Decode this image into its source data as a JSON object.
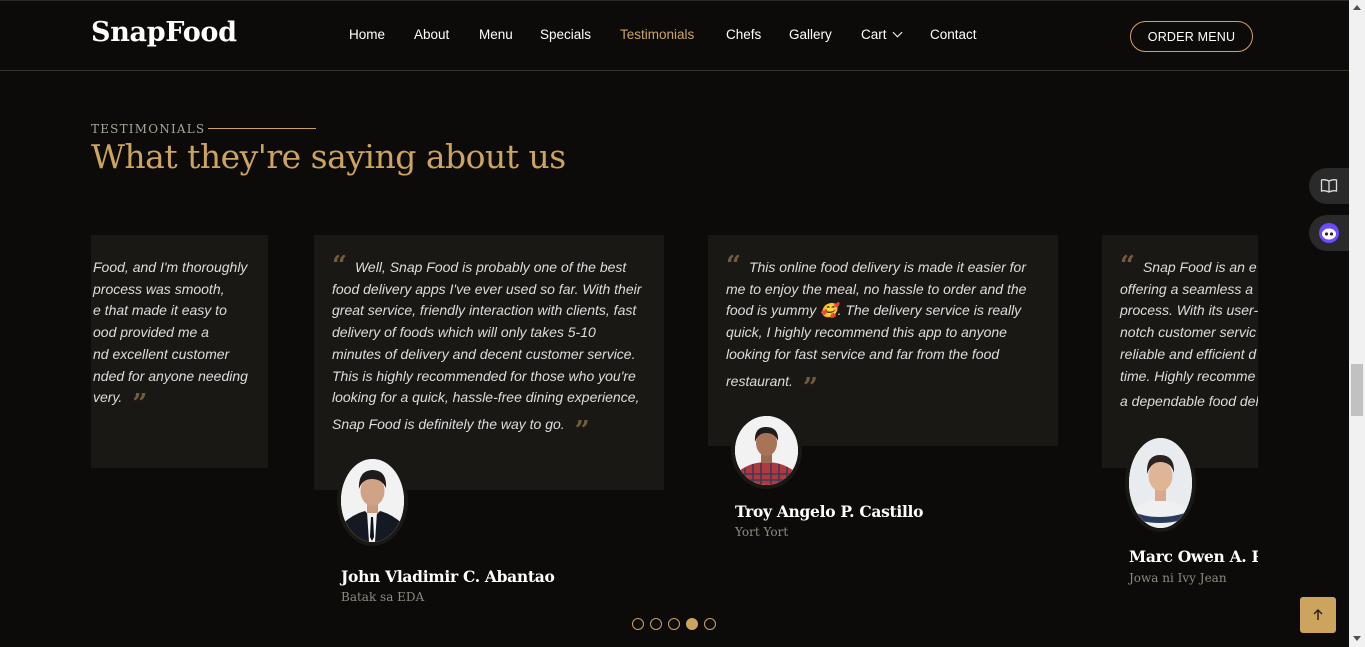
{
  "header": {
    "logo": "SnapFood",
    "nav": [
      {
        "label": "Home",
        "active": false
      },
      {
        "label": "About",
        "active": false
      },
      {
        "label": "Menu",
        "active": false
      },
      {
        "label": "Specials",
        "active": false
      },
      {
        "label": "Testimonials",
        "active": true
      },
      {
        "label": "Chefs",
        "active": false
      },
      {
        "label": "Gallery",
        "active": false
      },
      {
        "label": "Cart",
        "active": false,
        "dropdown": true
      },
      {
        "label": "Contact",
        "active": false
      }
    ],
    "order_button": "ORDER MENU"
  },
  "section": {
    "label": "TESTIMONIALS",
    "title": "What they're saying about us"
  },
  "testimonials": [
    {
      "text_lines": [
        "Food, and I'm thoroughly",
        "process was smooth,",
        "e that made it easy to",
        "ood provided me a",
        "nd excellent customer",
        "nded for anyone needing",
        "very."
      ]
    },
    {
      "text_lines": [
        "Well, Snap Food is probably one of the best",
        "food delivery apps I've ever used so far. With their",
        "great service, friendly interaction with clients, fast",
        "delivery of foods which will only takes 5-10",
        "minutes of delivery and decent customer service.",
        "This is highly recommended for those who you're",
        "looking for a quick, hassle-free dining experience,",
        "Snap Food is definitely the way to go."
      ],
      "name": "John Vladimir C. Abantao",
      "role": "Batak sa EDA"
    },
    {
      "text_lines": [
        "This online food delivery is made it easier for",
        "me to enjoy the meal, no hassle to order and the",
        "food is yummy 🥰. The delivery service is really",
        "quick, I highly recommend this app to anyone",
        "looking for fast service and far from the food",
        "restaurant."
      ],
      "name": "Troy Angelo P. Castillo",
      "role": "Yort Yort"
    },
    {
      "text_lines": [
        "Snap Food is an e",
        "offering a seamless a",
        "process. With its user-",
        "notch customer servic",
        "reliable and efficient d",
        "time. Highly recomme",
        "a dependable food del"
      ],
      "name": "Marc Owen A. Pal",
      "role": "Jowa ni Ivy Jean"
    }
  ],
  "pagination": {
    "count": 5,
    "active_index": 3
  },
  "side_tools": [
    {
      "icon": "book-icon"
    },
    {
      "icon": "assistant-bot-icon"
    }
  ],
  "back_to_top_icon": "arrow-up-icon",
  "colors": {
    "accent": "#cda45e",
    "background": "#0c0b09",
    "card": "#1a1814"
  }
}
